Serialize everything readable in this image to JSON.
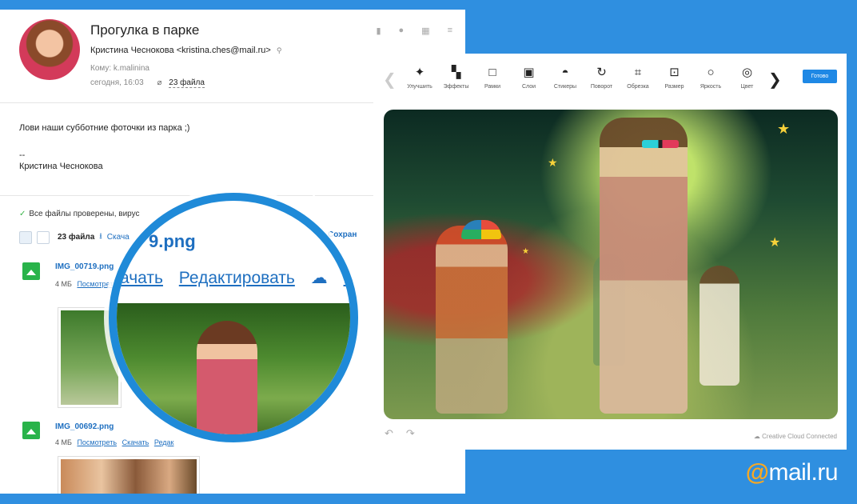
{
  "email": {
    "subject": "Прогулка в парке",
    "sender": "Кристина Чеснокова <kristina.ches@mail.ru>",
    "to": "Кому: k.malinina",
    "date": "сегодня, 16:03",
    "files_link": "23 файла",
    "body_line1": "Лови наши субботние фоточки из парка ;)",
    "signature_dash": "--",
    "signature_name": "Кристина Чеснокова",
    "check_text": "Все файлы проверены, вирус",
    "files_count": "23 файла",
    "download_link": "Скача",
    "save_link": "Сохран",
    "files": [
      {
        "name": "IMG_00719.png",
        "size": "4 МБ",
        "view": "Посмотреть",
        "download": "Скачать",
        "edit": "Редактировать"
      },
      {
        "name": "IMG_00692.png",
        "size": "4 МБ",
        "view": "Посмотреть",
        "download": "Скачать",
        "edit": "Редак"
      }
    ]
  },
  "magnifier": {
    "filename": "9.png",
    "link_download": "ачать",
    "link_edit": "Редактировать",
    "link_cloud": "В О"
  },
  "editor": {
    "tools": [
      {
        "label": "Улучшить",
        "icon": "wand-icon",
        "glyph": "✦"
      },
      {
        "label": "Эффекты",
        "icon": "effects-icon",
        "glyph": "▚"
      },
      {
        "label": "Рамки",
        "icon": "frame-icon",
        "glyph": "□"
      },
      {
        "label": "Слои",
        "icon": "layers-icon",
        "glyph": "▣"
      },
      {
        "label": "Стикеры",
        "icon": "sticker-icon",
        "glyph": "◓"
      },
      {
        "label": "Поворот",
        "icon": "rotate-icon",
        "glyph": "↻"
      },
      {
        "label": "Обрезка",
        "icon": "crop-icon",
        "glyph": "⌗"
      },
      {
        "label": "Размер",
        "icon": "resize-icon",
        "glyph": "⊡"
      },
      {
        "label": "Яркость",
        "icon": "brightness-icon",
        "glyph": "○"
      },
      {
        "label": "Цвет",
        "icon": "color-icon",
        "glyph": "◎"
      }
    ],
    "done_label": "Готово",
    "cc_text": "Creative Cloud Connected"
  },
  "logo": {
    "at": "@",
    "text": "mail.ru"
  },
  "colors": {
    "background": "#2f8fe0",
    "accent": "#1e88e5",
    "link": "#1e6fc0",
    "logo_at": "#f7a823"
  }
}
